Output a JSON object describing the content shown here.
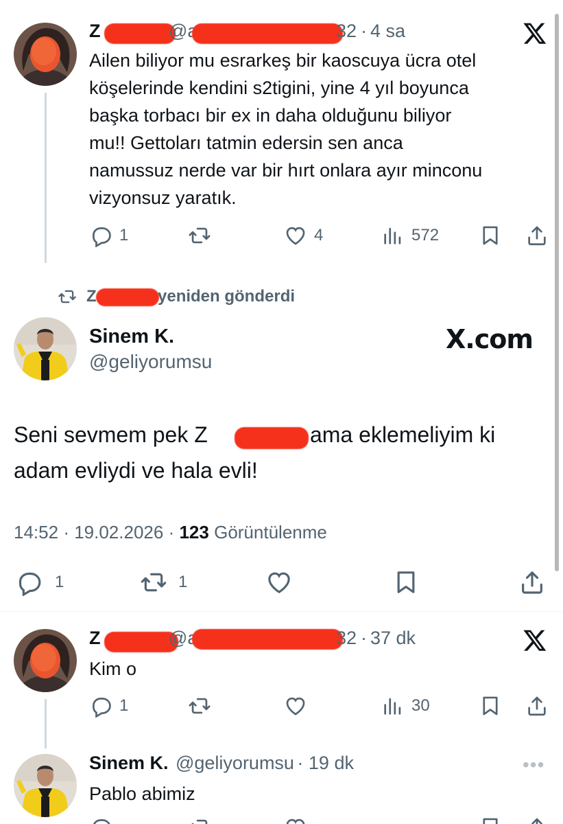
{
  "tweet1": {
    "name_prefix": "Z",
    "handle_prefix": "@a",
    "handle_suffix": "32",
    "time": "4 sa",
    "text_lines": [
      "Ailen biliyor mu esrarkeş bir kaoscuya ücra otel",
      "köşelerinde kendini s2tigini, yine 4 yıl boyunca",
      "başka torbacı bir ex in daha olduğunu biliyor",
      "mu!! Gettoları tatmin edersin sen anca",
      "namussuz nerde var bir hırt onlara ayır minconu",
      "vizyonsuz yaratık."
    ],
    "replies": "1",
    "retweets": "",
    "likes": "4",
    "views": "572"
  },
  "repost": {
    "prefix": "Z",
    "label": "yeniden gönderdi"
  },
  "main_tweet": {
    "name": "Sinem K.",
    "handle": "@geliyorumsu",
    "xcom": "X.com",
    "text_line1_a": "Seni sevmem pek Z",
    "text_line1_b": "ama eklemeliyim ki",
    "text_line2": "adam evliydi ve hala evli!",
    "time": "14:52",
    "date": "19.02.2026",
    "views_count": "123",
    "views_label": "Görüntülenme",
    "replies": "1",
    "retweets": "1"
  },
  "tweet3": {
    "name_prefix": "Z",
    "handle_prefix": "@a",
    "handle_suffix": "32",
    "time": "37 dk",
    "text": "Kim o",
    "replies": "1",
    "views": "30"
  },
  "tweet4": {
    "name": "Sinem K.",
    "handle": "@geliyorumsu",
    "time": "19 dk",
    "text": "Pablo abimiz"
  },
  "icons": {
    "reply": "reply-icon",
    "retweet": "retweet-icon",
    "like": "heart-icon",
    "views": "views-icon",
    "bookmark": "bookmark-icon",
    "share": "share-icon",
    "x": "x-logo-icon",
    "more": "more-icon"
  },
  "colors": {
    "text": "#0f1419",
    "muted": "#536471",
    "redaction": "#f5311c",
    "thread_line": "#cfd9de"
  }
}
